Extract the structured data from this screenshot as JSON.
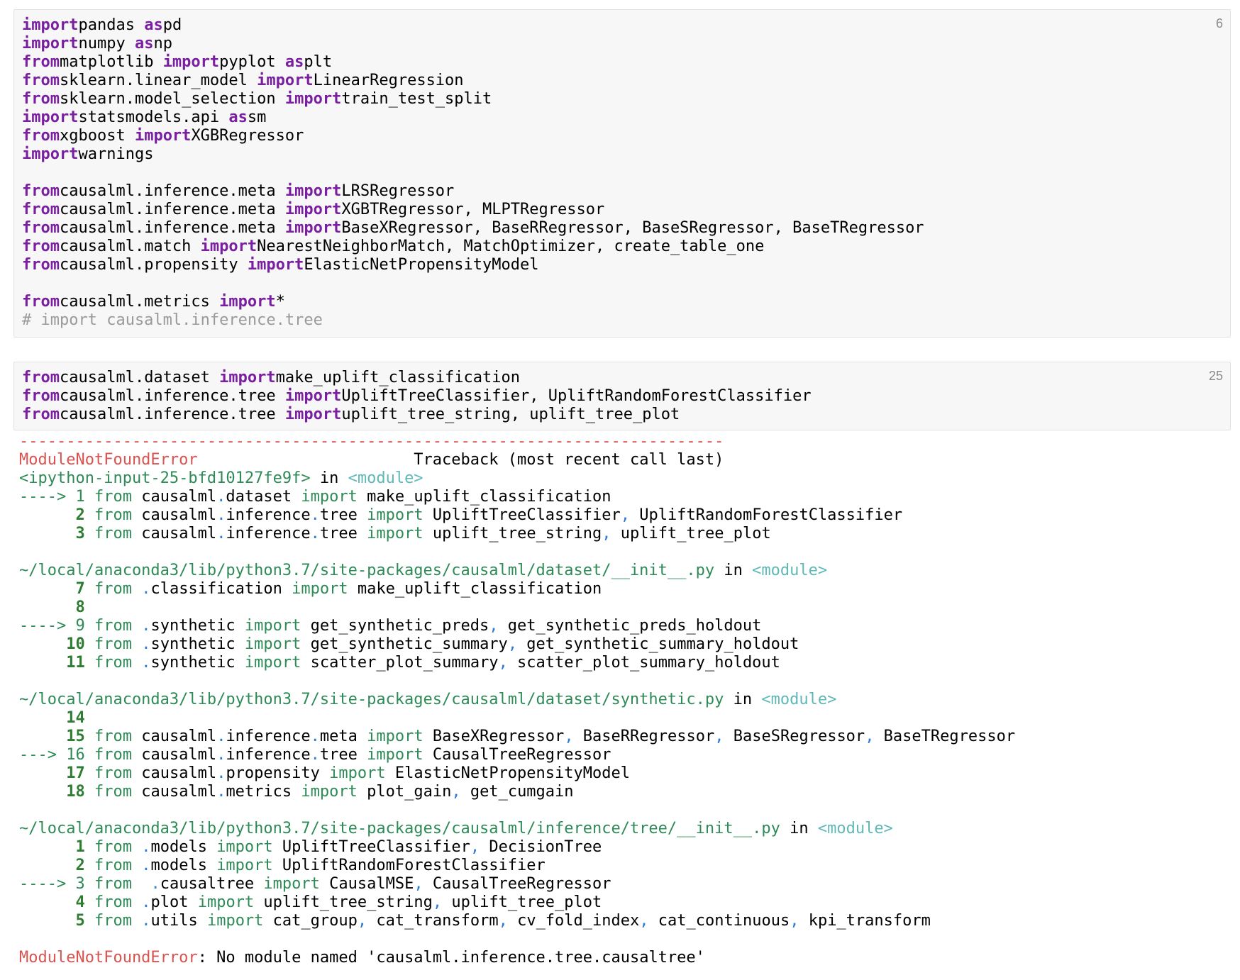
{
  "cells": [
    {
      "exec_count": "6",
      "lines": [
        [
          [
            "kw",
            "import"
          ],
          [
            "",
            "pandas "
          ],
          [
            "kw",
            "as"
          ],
          [
            "",
            "pd"
          ]
        ],
        [
          [
            "kw",
            "import"
          ],
          [
            "",
            "numpy "
          ],
          [
            "kw",
            "as"
          ],
          [
            "",
            "np"
          ]
        ],
        [
          [
            "kw",
            "from"
          ],
          [
            "",
            "matplotlib "
          ],
          [
            "kw",
            "import"
          ],
          [
            "",
            "pyplot "
          ],
          [
            "kw",
            "as"
          ],
          [
            "",
            "plt"
          ]
        ],
        [
          [
            "kw",
            "from"
          ],
          [
            "",
            "sklearn.linear_model "
          ],
          [
            "kw",
            "import"
          ],
          [
            "",
            "LinearRegression"
          ]
        ],
        [
          [
            "kw",
            "from"
          ],
          [
            "",
            "sklearn.model_selection "
          ],
          [
            "kw",
            "import"
          ],
          [
            "",
            "train_test_split"
          ]
        ],
        [
          [
            "kw",
            "import"
          ],
          [
            "",
            "statsmodels.api "
          ],
          [
            "kw",
            "as"
          ],
          [
            "",
            "sm"
          ]
        ],
        [
          [
            "kw",
            "from"
          ],
          [
            "",
            "xgboost "
          ],
          [
            "kw",
            "import"
          ],
          [
            "",
            "XGBRegressor"
          ]
        ],
        [
          [
            "kw",
            "import"
          ],
          [
            "",
            "warnings"
          ]
        ],
        [],
        [
          [
            "kw",
            "from"
          ],
          [
            "",
            "causalml.inference.meta "
          ],
          [
            "kw",
            "import"
          ],
          [
            "",
            "LRSRegressor"
          ]
        ],
        [
          [
            "kw",
            "from"
          ],
          [
            "",
            "causalml.inference.meta "
          ],
          [
            "kw",
            "import"
          ],
          [
            "",
            "XGBTRegressor, MLPTRegressor"
          ]
        ],
        [
          [
            "kw",
            "from"
          ],
          [
            "",
            "causalml.inference.meta "
          ],
          [
            "kw",
            "import"
          ],
          [
            "",
            "BaseXRegressor, BaseRRegressor, BaseSRegressor, BaseTRegressor"
          ]
        ],
        [
          [
            "kw",
            "from"
          ],
          [
            "",
            "causalml.match "
          ],
          [
            "kw",
            "import"
          ],
          [
            "",
            "NearestNeighborMatch, MatchOptimizer, create_table_one"
          ]
        ],
        [
          [
            "kw",
            "from"
          ],
          [
            "",
            "causalml.propensity "
          ],
          [
            "kw",
            "import"
          ],
          [
            "",
            "ElasticNetPropensityModel"
          ]
        ],
        [],
        [
          [
            "kw",
            "from"
          ],
          [
            "",
            "causalml.metrics "
          ],
          [
            "kw",
            "import"
          ],
          [
            "",
            "*"
          ]
        ],
        [
          [
            "cmt",
            "# import causalml.inference.tree"
          ]
        ]
      ]
    },
    {
      "exec_count": "25",
      "lines": [
        [
          [
            "kw",
            "from"
          ],
          [
            "",
            "causalml.dataset "
          ],
          [
            "kw",
            "import"
          ],
          [
            "",
            "make_uplift_classification"
          ]
        ],
        [
          [
            "kw",
            "from"
          ],
          [
            "",
            "causalml.inference.tree "
          ],
          [
            "kw",
            "import"
          ],
          [
            "",
            "UpliftTreeClassifier, UpliftRandomForestClassifier"
          ]
        ],
        [
          [
            "kw",
            "from"
          ],
          [
            "",
            "causalml.inference.tree "
          ],
          [
            "kw",
            "import"
          ],
          [
            "",
            "uplift_tree_string, uplift_tree_plot"
          ]
        ]
      ]
    }
  ],
  "traceback": [
    [
      [
        "tb-red",
        "---------------------------------------------------------------------------"
      ]
    ],
    [
      [
        "tb-red",
        "ModuleNotFoundError"
      ],
      [
        "",
        "                       Traceback (most recent call last)"
      ]
    ],
    [
      [
        "tb-green",
        "<ipython-input-25-bfd10127fe9f>"
      ],
      [
        "",
        " in "
      ],
      [
        "tb-cyan",
        "<module>"
      ]
    ],
    [
      [
        "tb-green",
        "----> 1 "
      ],
      [
        "tb-green",
        "from"
      ],
      [
        "",
        " causalml"
      ],
      [
        "tb-blue",
        "."
      ],
      [
        "",
        "dataset "
      ],
      [
        "tb-green",
        "import"
      ],
      [
        "",
        " make_uplift_classification"
      ]
    ],
    [
      [
        "",
        "      "
      ],
      [
        "tb-num",
        "2"
      ],
      [
        "",
        ""
      ],
      [
        "tb-green",
        " from"
      ],
      [
        "",
        " causalml"
      ],
      [
        "tb-blue",
        "."
      ],
      [
        "",
        "inference"
      ],
      [
        "tb-blue",
        "."
      ],
      [
        "",
        "tree "
      ],
      [
        "tb-green",
        "import"
      ],
      [
        "",
        " UpliftTreeClassifier"
      ],
      [
        "tb-blue",
        ","
      ],
      [
        "",
        " UpliftRandomForestClassifier"
      ]
    ],
    [
      [
        "",
        "      "
      ],
      [
        "tb-num",
        "3"
      ],
      [
        "tb-green",
        " from"
      ],
      [
        "",
        " causalml"
      ],
      [
        "tb-blue",
        "."
      ],
      [
        "",
        "inference"
      ],
      [
        "tb-blue",
        "."
      ],
      [
        "",
        "tree "
      ],
      [
        "tb-green",
        "import"
      ],
      [
        "",
        " uplift_tree_string"
      ],
      [
        "tb-blue",
        ","
      ],
      [
        "",
        " uplift_tree_plot"
      ]
    ],
    [],
    [
      [
        "tb-green",
        "~/local/anaconda3/lib/python3.7/site-packages/causalml/dataset/__init__.py"
      ],
      [
        "",
        " in "
      ],
      [
        "tb-cyan",
        "<module>"
      ]
    ],
    [
      [
        "",
        "      "
      ],
      [
        "tb-num",
        "7"
      ],
      [
        "tb-green",
        " from"
      ],
      [
        "tb-blue",
        " ."
      ],
      [
        "",
        "classification "
      ],
      [
        "tb-green",
        "import"
      ],
      [
        "",
        " make_uplift_classification"
      ]
    ],
    [
      [
        "",
        "      "
      ],
      [
        "tb-num",
        "8"
      ]
    ],
    [
      [
        "tb-green",
        "----> 9 "
      ],
      [
        "tb-green",
        "from"
      ],
      [
        "tb-blue",
        " ."
      ],
      [
        "",
        "synthetic "
      ],
      [
        "tb-green",
        "import"
      ],
      [
        "",
        " get_synthetic_preds"
      ],
      [
        "tb-blue",
        ","
      ],
      [
        "",
        " get_synthetic_preds_holdout"
      ]
    ],
    [
      [
        "",
        "     "
      ],
      [
        "tb-num",
        "10"
      ],
      [
        "tb-green",
        " from"
      ],
      [
        "tb-blue",
        " ."
      ],
      [
        "",
        "synthetic "
      ],
      [
        "tb-green",
        "import"
      ],
      [
        "",
        " get_synthetic_summary"
      ],
      [
        "tb-blue",
        ","
      ],
      [
        "",
        " get_synthetic_summary_holdout"
      ]
    ],
    [
      [
        "",
        "     "
      ],
      [
        "tb-num",
        "11"
      ],
      [
        "tb-green",
        " from"
      ],
      [
        "tb-blue",
        " ."
      ],
      [
        "",
        "synthetic "
      ],
      [
        "tb-green",
        "import"
      ],
      [
        "",
        " scatter_plot_summary"
      ],
      [
        "tb-blue",
        ","
      ],
      [
        "",
        " scatter_plot_summary_holdout"
      ]
    ],
    [],
    [
      [
        "tb-green",
        "~/local/anaconda3/lib/python3.7/site-packages/causalml/dataset/synthetic.py"
      ],
      [
        "",
        " in "
      ],
      [
        "tb-cyan",
        "<module>"
      ]
    ],
    [
      [
        "",
        "     "
      ],
      [
        "tb-num",
        "14"
      ]
    ],
    [
      [
        "",
        "     "
      ],
      [
        "tb-num",
        "15"
      ],
      [
        "tb-green",
        " from"
      ],
      [
        "",
        " causalml"
      ],
      [
        "tb-blue",
        "."
      ],
      [
        "",
        "inference"
      ],
      [
        "tb-blue",
        "."
      ],
      [
        "",
        "meta "
      ],
      [
        "tb-green",
        "import"
      ],
      [
        "",
        " BaseXRegressor"
      ],
      [
        "tb-blue",
        ","
      ],
      [
        "",
        " BaseRRegressor"
      ],
      [
        "tb-blue",
        ","
      ],
      [
        "",
        " BaseSRegressor"
      ],
      [
        "tb-blue",
        ","
      ],
      [
        "",
        " BaseTRegressor"
      ]
    ],
    [
      [
        "tb-green",
        "---> 16 "
      ],
      [
        "tb-green",
        "from"
      ],
      [
        "",
        " causalml"
      ],
      [
        "tb-blue",
        "."
      ],
      [
        "",
        "inference"
      ],
      [
        "tb-blue",
        "."
      ],
      [
        "",
        "tree "
      ],
      [
        "tb-green",
        "import"
      ],
      [
        "",
        " CausalTreeRegressor"
      ]
    ],
    [
      [
        "",
        "     "
      ],
      [
        "tb-num",
        "17"
      ],
      [
        "tb-green",
        " from"
      ],
      [
        "",
        " causalml"
      ],
      [
        "tb-blue",
        "."
      ],
      [
        "",
        "propensity "
      ],
      [
        "tb-green",
        "import"
      ],
      [
        "",
        " ElasticNetPropensityModel"
      ]
    ],
    [
      [
        "",
        "     "
      ],
      [
        "tb-num",
        "18"
      ],
      [
        "tb-green",
        " from"
      ],
      [
        "",
        " causalml"
      ],
      [
        "tb-blue",
        "."
      ],
      [
        "",
        "metrics "
      ],
      [
        "tb-green",
        "import"
      ],
      [
        "",
        " plot_gain"
      ],
      [
        "tb-blue",
        ","
      ],
      [
        "",
        " get_cumgain"
      ]
    ],
    [],
    [
      [
        "tb-green",
        "~/local/anaconda3/lib/python3.7/site-packages/causalml/inference/tree/__init__.py"
      ],
      [
        "",
        " in "
      ],
      [
        "tb-cyan",
        "<module>"
      ]
    ],
    [
      [
        "",
        "      "
      ],
      [
        "tb-num",
        "1"
      ],
      [
        "tb-green",
        " from"
      ],
      [
        "tb-blue",
        " ."
      ],
      [
        "",
        "models "
      ],
      [
        "tb-green",
        "import"
      ],
      [
        "",
        " UpliftTreeClassifier"
      ],
      [
        "tb-blue",
        ","
      ],
      [
        "",
        " DecisionTree"
      ]
    ],
    [
      [
        "",
        "      "
      ],
      [
        "tb-num",
        "2"
      ],
      [
        "tb-green",
        " from"
      ],
      [
        "tb-blue",
        " ."
      ],
      [
        "",
        "models "
      ],
      [
        "tb-green",
        "import"
      ],
      [
        "",
        " UpliftRandomForestClassifier"
      ]
    ],
    [
      [
        "tb-green",
        "----> 3 "
      ],
      [
        "tb-green",
        "from"
      ],
      [
        "tb-blue",
        "  ."
      ],
      [
        "",
        "causaltree "
      ],
      [
        "tb-green",
        "import"
      ],
      [
        "",
        " CausalMSE"
      ],
      [
        "tb-blue",
        ","
      ],
      [
        "",
        " CausalTreeRegressor"
      ]
    ],
    [
      [
        "",
        "      "
      ],
      [
        "tb-num",
        "4"
      ],
      [
        "tb-green",
        " from"
      ],
      [
        "tb-blue",
        " ."
      ],
      [
        "",
        "plot "
      ],
      [
        "tb-green",
        "import"
      ],
      [
        "",
        " uplift_tree_string"
      ],
      [
        "tb-blue",
        ","
      ],
      [
        "",
        " uplift_tree_plot"
      ]
    ],
    [
      [
        "",
        "      "
      ],
      [
        "tb-num",
        "5"
      ],
      [
        "tb-green",
        " from"
      ],
      [
        "tb-blue",
        " ."
      ],
      [
        "",
        "utils "
      ],
      [
        "tb-green",
        "import"
      ],
      [
        "",
        " cat_group"
      ],
      [
        "tb-blue",
        ","
      ],
      [
        "",
        " cat_transform"
      ],
      [
        "tb-blue",
        ","
      ],
      [
        "",
        " cv_fold_index"
      ],
      [
        "tb-blue",
        ","
      ],
      [
        "",
        " cat_continuous"
      ],
      [
        "tb-blue",
        ","
      ],
      [
        "",
        " kpi_transform"
      ]
    ],
    [],
    [
      [
        "tb-red",
        "ModuleNotFoundError"
      ],
      [
        "",
        ": No module named 'causalml.inference.tree.causaltree'"
      ]
    ]
  ]
}
